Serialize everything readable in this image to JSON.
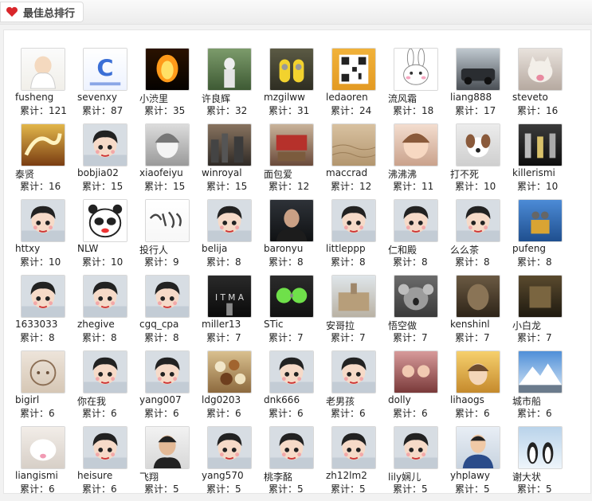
{
  "header": {
    "title": "最佳总排行",
    "icon": "heart-icon"
  },
  "count_label": "累计：",
  "users": [
    {
      "name": "fusheng",
      "count": "121",
      "avatar": "baby-photo"
    },
    {
      "name": "sevenxy",
      "count": "87",
      "avatar": "logo-c"
    },
    {
      "name": "小渋里",
      "count": "35",
      "avatar": "fire-photo"
    },
    {
      "name": "许良辉",
      "count": "32",
      "avatar": "statue-photo"
    },
    {
      "name": "mzgilww",
      "count": "31",
      "avatar": "minion-photo"
    },
    {
      "name": "ledaoren",
      "count": "24",
      "avatar": "qr-code"
    },
    {
      "name": "流风霜",
      "count": "18",
      "avatar": "rabbit-cartoon"
    },
    {
      "name": "liang888",
      "count": "17",
      "avatar": "car-photo"
    },
    {
      "name": "steveto",
      "count": "16",
      "avatar": "kitten-photo"
    },
    {
      "name": "泰贤",
      "count": "16",
      "avatar": "dragon-art"
    },
    {
      "name": "bobjia02",
      "count": "15",
      "avatar": "default-avatar"
    },
    {
      "name": "xiaofeiyu",
      "count": "15",
      "avatar": "anime-sketch"
    },
    {
      "name": "winroyal",
      "count": "15",
      "avatar": "city-photo"
    },
    {
      "name": "面包爱",
      "count": "12",
      "avatar": "room-photo"
    },
    {
      "name": "maccrad",
      "count": "12",
      "avatar": "sand-photo"
    },
    {
      "name": "沸沸沸",
      "count": "11",
      "avatar": "girl-photo"
    },
    {
      "name": "打不死",
      "count": "10",
      "avatar": "puppy-photo"
    },
    {
      "name": "killerismi",
      "count": "10",
      "avatar": "robots-photo"
    },
    {
      "name": "httxy",
      "count": "10",
      "avatar": "default-avatar"
    },
    {
      "name": "NLW",
      "count": "10",
      "avatar": "panda-cartoon"
    },
    {
      "name": "投行人",
      "count": "9",
      "avatar": "calligraphy"
    },
    {
      "name": "belija",
      "count": "8",
      "avatar": "default-avatar"
    },
    {
      "name": "baronyu",
      "count": "8",
      "avatar": "man-photo"
    },
    {
      "name": "littleppp",
      "count": "8",
      "avatar": "default-avatar"
    },
    {
      "name": "仁和殿",
      "count": "8",
      "avatar": "default-avatar"
    },
    {
      "name": "么么茶",
      "count": "8",
      "avatar": "default-avatar"
    },
    {
      "name": "pufeng",
      "count": "8",
      "avatar": "walle-photo"
    },
    {
      "name": "1633033",
      "count": "8",
      "avatar": "default-avatar"
    },
    {
      "name": "zhegive",
      "count": "8",
      "avatar": "default-avatar"
    },
    {
      "name": "cgq_cpa",
      "count": "8",
      "avatar": "default-avatar"
    },
    {
      "name": "miller13",
      "count": "7",
      "avatar": "hitman-poster"
    },
    {
      "name": "STic",
      "count": "7",
      "avatar": "goggles-icon"
    },
    {
      "name": "安哥拉",
      "count": "7",
      "avatar": "building-photo"
    },
    {
      "name": "悟空做",
      "count": "7",
      "avatar": "koala-photo"
    },
    {
      "name": "kenshinl",
      "count": "7",
      "avatar": "face-art"
    },
    {
      "name": "小白龙",
      "count": "7",
      "avatar": "dark-room-photo"
    },
    {
      "name": "bigirl",
      "count": "6",
      "avatar": "sketch-girl"
    },
    {
      "name": "你在我",
      "count": "6",
      "avatar": "default-avatar"
    },
    {
      "name": "yang007",
      "count": "6",
      "avatar": "default-avatar"
    },
    {
      "name": "ldg0203",
      "count": "6",
      "avatar": "food-photo"
    },
    {
      "name": "dnk666",
      "count": "6",
      "avatar": "default-avatar"
    },
    {
      "name": "老男孩",
      "count": "6",
      "avatar": "default-avatar"
    },
    {
      "name": "dolly",
      "count": "6",
      "avatar": "kids-photo"
    },
    {
      "name": "lihaogs",
      "count": "6",
      "avatar": "anime-boy"
    },
    {
      "name": "城市船",
      "count": "6",
      "avatar": "mountain-photo"
    },
    {
      "name": "liangismi",
      "count": "6",
      "avatar": "white-cat-photo"
    },
    {
      "name": "heisure",
      "count": "6",
      "avatar": "default-avatar"
    },
    {
      "name": "飞翔",
      "count": "5",
      "avatar": "smiling-man-photo"
    },
    {
      "name": "yang570",
      "count": "5",
      "avatar": "default-avatar"
    },
    {
      "name": "桃李酩",
      "count": "5",
      "avatar": "default-avatar"
    },
    {
      "name": "zh12lm2",
      "count": "5",
      "avatar": "default-avatar"
    },
    {
      "name": "lily娴儿",
      "count": "5",
      "avatar": "default-avatar"
    },
    {
      "name": "yhplawy",
      "count": "5",
      "avatar": "suit-man-photo"
    },
    {
      "name": "谢大状",
      "count": "5",
      "avatar": "penguins-photo"
    }
  ]
}
